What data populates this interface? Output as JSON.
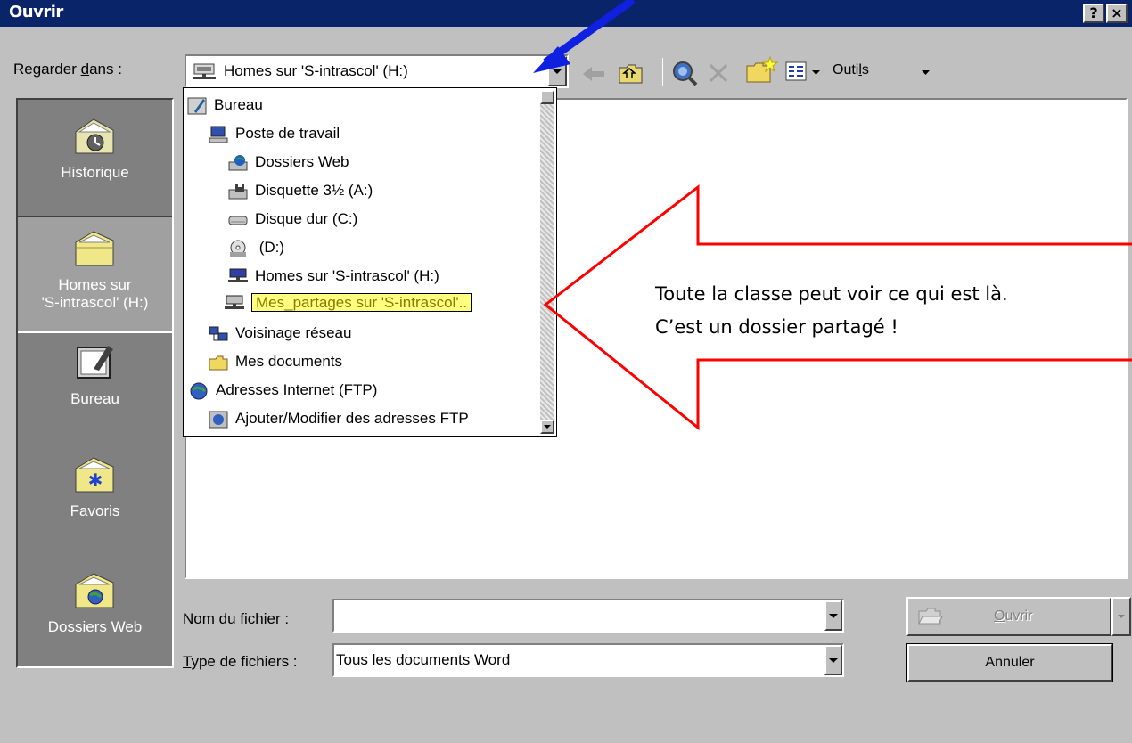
{
  "window": {
    "title": "Ouvrir",
    "help_button": "?",
    "close_button": "×"
  },
  "look_in": {
    "label_prefix": "Regarder ",
    "label_accel": "d",
    "label_suffix": "ans :",
    "value": "Homes sur 'S-intrascol' (H:)"
  },
  "toolbar": {
    "tools_prefix": "Outi",
    "tools_accel": "l",
    "tools_suffix": "s"
  },
  "dropdown": {
    "items": [
      {
        "label": "Bureau",
        "icon": "desktop-icon"
      },
      {
        "label": "Poste de travail",
        "icon": "computer-icon"
      },
      {
        "label": "Dossiers Web",
        "icon": "web-folders-icon"
      },
      {
        "label": "Disquette 3½ (A:)",
        "icon": "floppy-icon"
      },
      {
        "label": "Disque dur (C:)",
        "icon": "hard-disk-icon"
      },
      {
        "label": " (D:)",
        "icon": "cd-drive-icon"
      },
      {
        "label": "Homes sur 'S-intrascol' (H:)",
        "icon": "network-drive-icon"
      },
      {
        "label": "Mes_partages sur 'S-intrascol'..",
        "icon": "network-drive-icon"
      },
      {
        "label": "Voisinage réseau",
        "icon": "network-icon"
      },
      {
        "label": "Mes documents",
        "icon": "folder-icon"
      },
      {
        "label": "Adresses Internet (FTP)",
        "icon": "ftp-icon"
      },
      {
        "label": "Ajouter/Modifier des adresses FTP",
        "icon": "ftp-edit-icon"
      }
    ]
  },
  "places": [
    {
      "label": "Historique",
      "icon": "history-icon"
    },
    {
      "label": "Homes sur 'S-intrascol' (H:)",
      "label_line1": "Homes sur",
      "label_line2": "'S-intrascol' (H:)",
      "icon": "folder-icon"
    },
    {
      "label": "Bureau",
      "icon": "desktop-icon"
    },
    {
      "label": "Favoris",
      "icon": "favorites-icon"
    },
    {
      "label": "Dossiers Web",
      "icon": "web-folders-icon"
    }
  ],
  "file_name": {
    "label_prefix": "Nom du ",
    "label_accel": "f",
    "label_suffix": "ichier :",
    "value": ""
  },
  "file_type": {
    "label_accel": "T",
    "label_suffix": "ype de fichiers :",
    "value": "Tous les documents Word"
  },
  "buttons": {
    "open_accel": "O",
    "open_suffix": "uvrir",
    "cancel": "Annuler"
  },
  "callout": {
    "line1": "Toute la classe peut voir ce qui est là.",
    "line2": "C’est un dossier partagé !"
  },
  "colors": {
    "title_bar": "#0a246a",
    "callout_outline": "#ff0000",
    "arrow": "#1020e0",
    "highlight": "#ffff80"
  }
}
